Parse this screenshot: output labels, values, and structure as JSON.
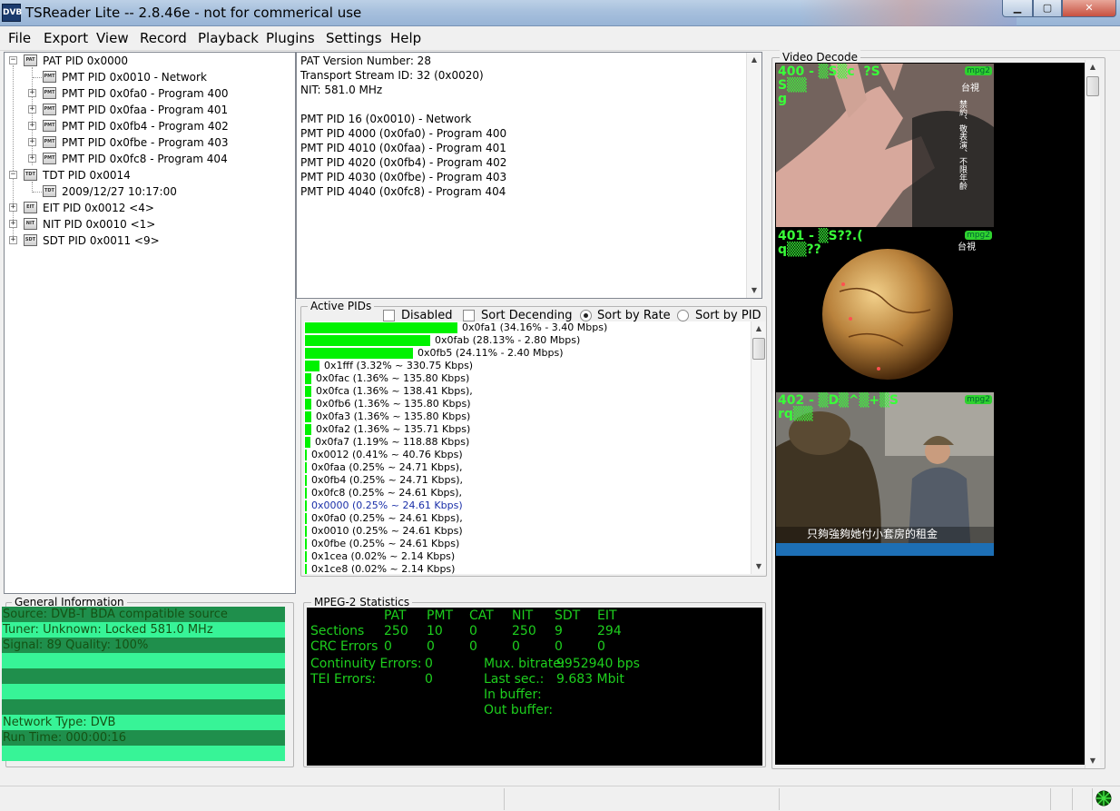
{
  "window": {
    "app_icon_text": "DVB",
    "title": "TSReader Lite -- 2.8.46e - not for commerical use",
    "minimize_icon": "minimize-icon",
    "maximize_icon": "maximize-icon",
    "close_icon": "close-icon"
  },
  "menu": [
    "File",
    "Export",
    "View",
    "Record",
    "Playback",
    "Plugins",
    "Settings",
    "Help"
  ],
  "tree": [
    {
      "icon": "PAT",
      "label": "PAT PID 0x0000"
    },
    {
      "icon": "PMT",
      "label": "PMT PID 0x0010 - Network"
    },
    {
      "icon": "PMT",
      "label": "PMT PID 0x0fa0 - Program 400"
    },
    {
      "icon": "PMT",
      "label": "PMT PID 0x0faa - Program 401"
    },
    {
      "icon": "PMT",
      "label": "PMT PID 0x0fb4 - Program 402"
    },
    {
      "icon": "PMT",
      "label": "PMT PID 0x0fbe - Program 403"
    },
    {
      "icon": "PMT",
      "label": "PMT PID 0x0fc8 - Program 404"
    },
    {
      "icon": "TDT",
      "label": "TDT PID 0x0014"
    },
    {
      "icon": "TDT",
      "label": "2009/12/27 10:17:00"
    },
    {
      "icon": "EIT",
      "label": "EIT PID 0x0012 <4>"
    },
    {
      "icon": "NIT",
      "label": "NIT PID 0x0010 <1>"
    },
    {
      "icon": "SDT",
      "label": "SDT PID 0x0011 <9>"
    }
  ],
  "details": [
    "PAT Version Number: 28",
    "Transport Stream ID: 32 (0x0020)",
    "NIT: 581.0 MHz",
    "",
    "PMT PID 16 (0x0010) - Network",
    "PMT PID 4000 (0x0fa0) - Program 400",
    "PMT PID 4010 (0x0faa) - Program 401",
    "PMT PID 4020 (0x0fb4) - Program 402",
    "PMT PID 4030 (0x0fbe) - Program 403",
    "PMT PID 4040 (0x0fc8) - Program 404"
  ],
  "active_pids": {
    "caption": "Active PIDs",
    "options": {
      "disabled": {
        "label": "Disabled",
        "checked": false
      },
      "sort_desc": {
        "label": "Sort Decending",
        "checked": false
      },
      "sort_rate": {
        "label": "Sort by Rate",
        "selected": true
      },
      "sort_pid": {
        "label": "Sort by PID",
        "selected": false
      }
    },
    "rows": [
      {
        "text": "0x0fa1 (34.16% - 3.40 Mbps)",
        "percent": 34.16
      },
      {
        "text": "0x0fab (28.13% - 2.80 Mbps)",
        "percent": 28.13
      },
      {
        "text": "0x0fb5 (24.11% - 2.40 Mbps)",
        "percent": 24.11
      },
      {
        "text": "0x1fff (3.32% ~ 330.75 Kbps)",
        "percent": 3.32
      },
      {
        "text": "0x0fac (1.36% ~ 135.80 Kbps)",
        "percent": 1.36
      },
      {
        "text": "0x0fca (1.36% ~ 138.41 Kbps),",
        "percent": 1.36
      },
      {
        "text": "0x0fb6 (1.36% ~ 135.80 Kbps)",
        "percent": 1.36
      },
      {
        "text": "0x0fa3 (1.36% ~ 135.80 Kbps)",
        "percent": 1.36
      },
      {
        "text": "0x0fa2 (1.36% ~ 135.71 Kbps)",
        "percent": 1.36
      },
      {
        "text": "0x0fa7 (1.19% ~ 118.88 Kbps)",
        "percent": 1.19
      },
      {
        "text": "0x0012 (0.41% ~ 40.76 Kbps)",
        "percent": 0.41
      },
      {
        "text": "0x0faa (0.25% ~ 24.71 Kbps),",
        "percent": 0.25
      },
      {
        "text": "0x0fb4 (0.25% ~ 24.71 Kbps),",
        "percent": 0.25
      },
      {
        "text": "0x0fc8 (0.25% ~ 24.61 Kbps),",
        "percent": 0.25
      },
      {
        "text": "0x0000 (0.25% ~ 24.61 Kbps)",
        "percent": 0.25,
        "highlight": true
      },
      {
        "text": "0x0fa0 (0.25% ~ 24.61 Kbps),",
        "percent": 0.25
      },
      {
        "text": "0x0010 (0.25% ~ 24.61 Kbps)",
        "percent": 0.25
      },
      {
        "text": "0x0fbe (0.25% ~ 24.61 Kbps)",
        "percent": 0.25
      },
      {
        "text": "0x1cea (0.02% ~ 2.14 Kbps)",
        "percent": 0.02
      },
      {
        "text": "0x1ce8 (0.02% ~ 2.14 Kbps)",
        "percent": 0.02
      }
    ]
  },
  "general_info": {
    "caption": "General Information",
    "rows": [
      "Source: DVB-T BDA compatible source",
      "Tuner: Unknown: Locked 581.0 MHz",
      "Signal: 89 Quality: 100%",
      "",
      "",
      "",
      "",
      "",
      "Network Type: DVB",
      "Run Time: 000:00:16",
      ""
    ]
  },
  "mpeg_stats": {
    "caption": "MPEG-2 Statistics",
    "columns": [
      "PAT",
      "PMT",
      "CAT",
      "NIT",
      "SDT",
      "EIT"
    ],
    "sections_label": "Sections",
    "sections": [
      "250",
      "10",
      "0",
      "250",
      "9",
      "294"
    ],
    "crc_label": "CRC Errors",
    "crc": [
      "0",
      "0",
      "0",
      "0",
      "0",
      "0"
    ],
    "continuity_label": "Continuity Errors:",
    "continuity": "0",
    "tei_label": "TEI Errors:",
    "tei": "0",
    "mux_label": "Mux. bitrate:",
    "mux": "9952940 bps",
    "last_label": "Last sec.:",
    "last": "9.683 Mbit",
    "inbuf_label": "In buffer:",
    "outbuf_label": "Out buffer:"
  },
  "video": {
    "caption": "Video Decode",
    "frames": [
      {
        "osd": "400 - ▒S▒c  ?S\nS▒▒\ng",
        "badge": "mpg2",
        "logo": "台視",
        "subtitle": ""
      },
      {
        "osd": "401 - ▒S??.(\nq▒▒??",
        "badge": "mpg2",
        "logo": "台視",
        "subtitle": ""
      },
      {
        "osd": "402 - ▒D▒^▒+▒S\nrq▒▒",
        "badge": "mpg2",
        "logo": "",
        "subtitle": "只夠強夠她付小套房的租金"
      }
    ]
  },
  "colors": {
    "bar": "#00f200",
    "stats_text": "#1ecf1e",
    "info_dark": "#1f8f4c",
    "info_light": "#37f497"
  }
}
